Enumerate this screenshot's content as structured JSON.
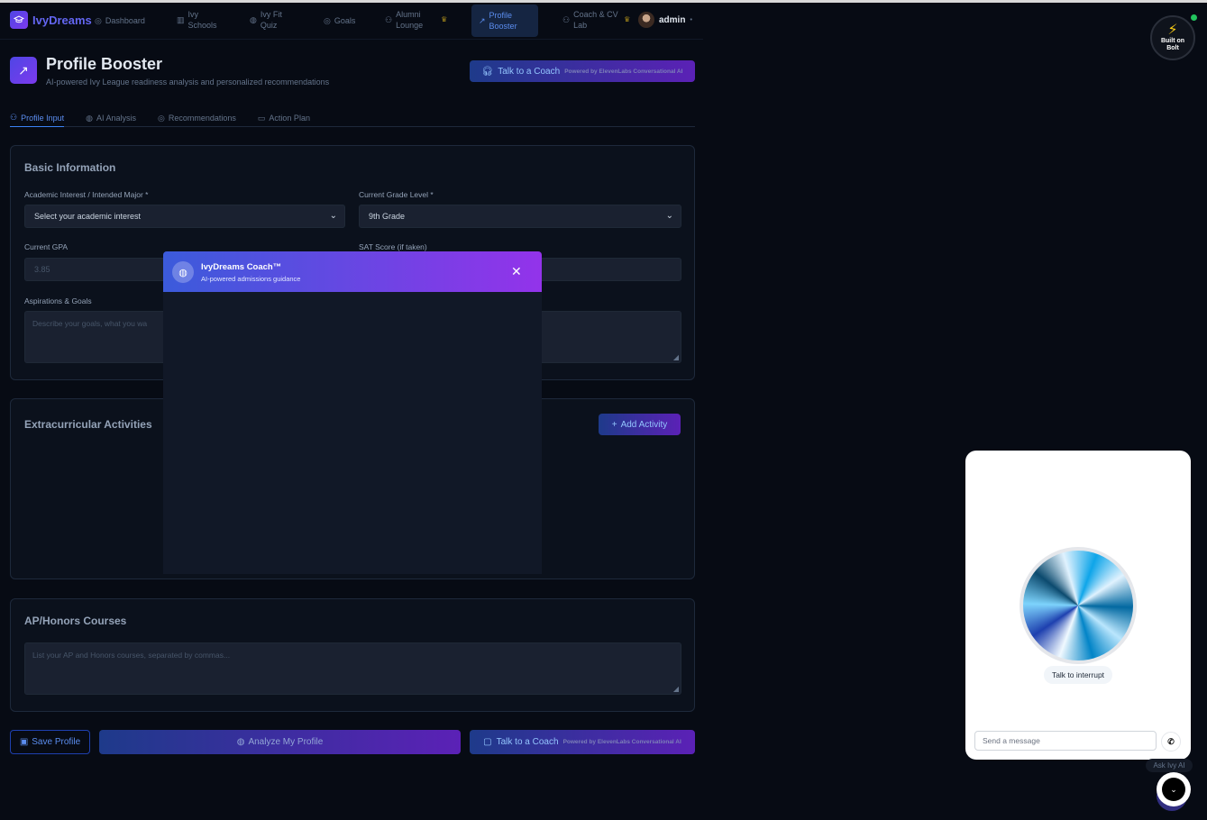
{
  "nav": {
    "logo": "IvyDreams",
    "items": [
      {
        "label": "Dashboard",
        "icon": "gauge-icon"
      },
      {
        "label": "Ivy Schools",
        "icon": "building-icon"
      },
      {
        "label": "Ivy Fit Quiz",
        "icon": "brain-icon"
      },
      {
        "label": "Goals",
        "icon": "target-icon"
      },
      {
        "label": "Alumni Lounge",
        "icon": "users-icon"
      },
      {
        "label": "Profile Booster",
        "icon": "trending-up-icon"
      },
      {
        "label": "Coach & CV Lab",
        "icon": "user-icon"
      }
    ],
    "user": "admin"
  },
  "header": {
    "title": "Profile Booster",
    "subtitle": "AI-powered Ivy League readiness analysis and personalized recommendations",
    "coach_button": "Talk to a Coach",
    "coach_powered": "Powered by ElevenLabs Conversational AI"
  },
  "tabs": [
    "Profile Input",
    "AI Analysis",
    "Recommendations",
    "Action Plan"
  ],
  "basic_info": {
    "title": "Basic Information",
    "major_label": "Academic Interest / Intended Major *",
    "major_value": "Select your academic interest",
    "grade_label": "Current Grade Level *",
    "grade_value": "9th Grade",
    "gpa_label": "Current GPA",
    "gpa_placeholder": "3.85",
    "sat_label": "SAT Score (if taken)",
    "aspirations_label": "Aspirations & Goals",
    "aspirations_placeholder": "Describe your goals, what you wa"
  },
  "extracurricular": {
    "title": "Extracurricular Activities",
    "add_button": "Add Activity"
  },
  "ap": {
    "title": "AP/Honors Courses",
    "placeholder": "List your AP and Honors courses, separated by commas..."
  },
  "actions": {
    "save": "Save Profile",
    "analyze": "Analyze My Profile",
    "coach": "Talk to a Coach",
    "coach_powered": "Powered by ElevenLabs Conversational AI"
  },
  "modal": {
    "title": "IvyDreams Coach™",
    "subtitle": "AI-powered admissions guidance"
  },
  "bolt": {
    "line1": "Built on",
    "line2": "Bolt"
  },
  "widget": {
    "interrupt": "Talk to interrupt",
    "message_placeholder": "Send a message",
    "ask": "Ask Ivy AI"
  }
}
